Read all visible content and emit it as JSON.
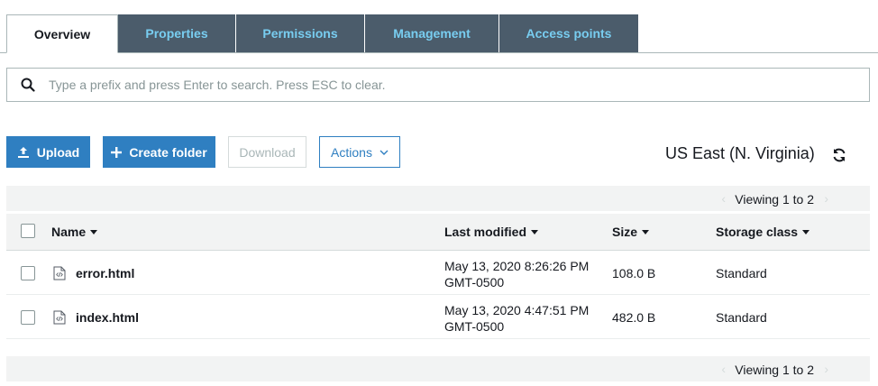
{
  "tabs": [
    {
      "label": "Overview",
      "active": true
    },
    {
      "label": "Properties",
      "active": false
    },
    {
      "label": "Permissions",
      "active": false
    },
    {
      "label": "Management",
      "active": false
    },
    {
      "label": "Access points",
      "active": false
    }
  ],
  "search": {
    "placeholder": "Type a prefix and press Enter to search. Press ESC to clear.",
    "icon": "search-icon"
  },
  "toolbar": {
    "upload_label": "Upload",
    "create_folder_label": "Create folder",
    "download_label": "Download",
    "actions_label": "Actions",
    "region": "US East (N. Virginia)"
  },
  "pager": {
    "text": "Viewing 1 to 2",
    "prev": "‹",
    "next": "›"
  },
  "table": {
    "columns": {
      "name": "Name",
      "last_modified": "Last modified",
      "size": "Size",
      "storage_class": "Storage class"
    },
    "rows": [
      {
        "name": "error.html",
        "modified_date": "May 13, 2020 8:26:26 PM",
        "modified_tz": "GMT-0500",
        "size": "108.0 B",
        "storage_class": "Standard"
      },
      {
        "name": "index.html",
        "modified_date": "May 13, 2020 4:47:51 PM",
        "modified_tz": "GMT-0500",
        "size": "482.0 B",
        "storage_class": "Standard"
      }
    ]
  },
  "colors": {
    "primary": "#2f7fc1",
    "tab_inactive_bg": "#4b5c6b",
    "tab_inactive_text": "#78cdf0",
    "header_bg": "#f2f3f3"
  }
}
